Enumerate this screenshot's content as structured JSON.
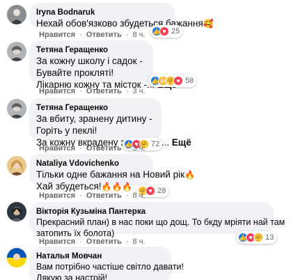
{
  "actions": {
    "like": "Нравится",
    "reply": "Ответить"
  },
  "comments": [
    {
      "author": "Iryna Bodnaruk",
      "lines": [
        "Нехай обов'язково збудеться бажання"
      ],
      "more": "",
      "emoji_end": "🥰",
      "time": "8 ч.",
      "reaction_icons": [
        "like-icon",
        "love-icon"
      ],
      "reaction_count": "25"
    },
    {
      "author": "Тетяна Геращенко",
      "lines": [
        "За кожну школу і садок -",
        "Бувайте прокляті!",
        "Лікарню кожну та місток -..."
      ],
      "more": "Ещё",
      "emoji_end": "",
      "time": "3 ч.",
      "reaction_icons": [
        "like-icon",
        "haha-icon",
        "care-icon",
        "love-icon"
      ],
      "reaction_count": "58"
    },
    {
      "author": "Тетяна Геращенко",
      "lines": [
        "За вбиту, зранену дитину -",
        "Горіть у пеклі!",
        "За кожну вкрадену зернину -..."
      ],
      "more": "Ещё",
      "emoji_end": "",
      "time": "3 ч.",
      "reaction_icons": [
        "like-icon",
        "love-icon",
        "care-icon"
      ],
      "reaction_count": "72"
    },
    {
      "author": "Nataliya Vdovichenko",
      "lines": [
        "Тільки одне бажання на Новий рік",
        "Хай збудеться!"
      ],
      "more": "",
      "emoji_end": "🔥",
      "emoji_line2": "🔥🔥🔥",
      "time": "8 ч.",
      "reaction_icons": [
        "care-icon",
        "love-icon"
      ],
      "reaction_count": "28"
    },
    {
      "author": "Вікторія Кузьміна Пантерка",
      "lines": [
        "Прекрасний план) в нас поки що дощ. То бкду мріяти най там",
        "затопить їх болота)"
      ],
      "more": "",
      "emoji_end": "",
      "time": "8 ч.",
      "reaction_icons": [
        "like-icon",
        "love-icon",
        "care-icon"
      ],
      "reaction_count": "13"
    },
    {
      "author": "Наталья Мовчан",
      "lines": [
        "Вам потрібно частіше світло давати!",
        "Дякую за настрій!"
      ],
      "more": "",
      "emoji_end": "",
      "time": "",
      "reaction_icons": [],
      "reaction_count": ""
    }
  ]
}
